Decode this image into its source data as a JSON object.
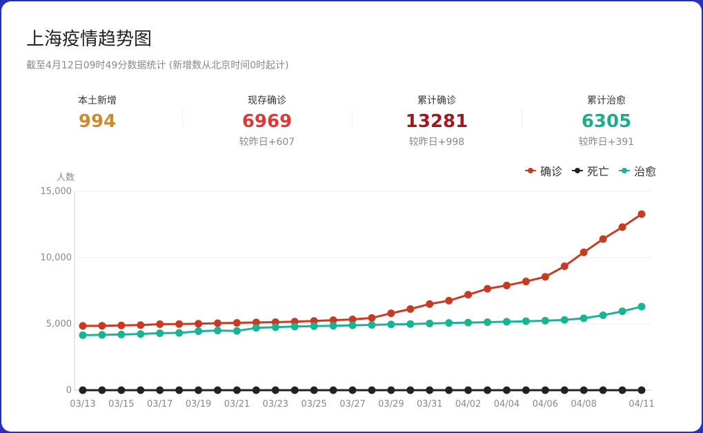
{
  "header": {
    "title": "上海疫情趋势图",
    "subtitle": "截至4月12日09时49分数据统计 (新增数从北京时间0时起计)"
  },
  "stats": [
    {
      "label": "本土新增",
      "value": "994",
      "delta": "",
      "color": "#d08a2c"
    },
    {
      "label": "现存确诊",
      "value": "6969",
      "delta": "较昨日+607",
      "color": "#e0383b"
    },
    {
      "label": "累计确诊",
      "value": "13281",
      "delta": "较昨日+998",
      "color": "#a5171f"
    },
    {
      "label": "累计治愈",
      "value": "6305",
      "delta": "较昨日+391",
      "color": "#1aae8c"
    }
  ],
  "chart_data": {
    "type": "line",
    "ylabel": "人数",
    "ylim": [
      0,
      15000
    ],
    "yticks": [
      "0",
      "5,000",
      "10,000",
      "15,000"
    ],
    "x": [
      "03/13",
      "03/14",
      "03/15",
      "03/16",
      "03/17",
      "03/18",
      "03/19",
      "03/20",
      "03/21",
      "03/22",
      "03/23",
      "03/24",
      "03/25",
      "03/26",
      "03/27",
      "03/28",
      "03/29",
      "03/30",
      "03/31",
      "04/01",
      "04/02",
      "04/03",
      "04/04",
      "04/05",
      "04/06",
      "04/07",
      "04/08",
      "04/09",
      "04/10",
      "04/11"
    ],
    "xtick_labels": [
      "03/13",
      "03/15",
      "03/17",
      "03/19",
      "03/21",
      "03/23",
      "03/25",
      "03/27",
      "03/29",
      "03/31",
      "04/02",
      "04/04",
      "04/06",
      "04/08",
      "04/11"
    ],
    "legend_position": "top-right",
    "grid": true,
    "series": [
      {
        "name": "确诊",
        "color": "#c93a25",
        "values": [
          4850,
          4860,
          4880,
          4910,
          4980,
          4990,
          5010,
          5050,
          5080,
          5110,
          5130,
          5170,
          5220,
          5280,
          5340,
          5450,
          5800,
          6120,
          6500,
          6750,
          7200,
          7650,
          7900,
          8200,
          8550,
          9350,
          10400,
          11400,
          12300,
          13281
        ]
      },
      {
        "name": "死亡",
        "color": "#222222",
        "values": [
          0,
          0,
          0,
          0,
          0,
          0,
          0,
          0,
          0,
          0,
          0,
          0,
          0,
          0,
          0,
          0,
          0,
          0,
          0,
          0,
          0,
          0,
          0,
          0,
          0,
          0,
          0,
          0,
          0,
          0
        ]
      },
      {
        "name": "治愈",
        "color": "#1ab394",
        "values": [
          4150,
          4170,
          4200,
          4240,
          4300,
          4320,
          4450,
          4500,
          4470,
          4700,
          4750,
          4800,
          4830,
          4860,
          4890,
          4920,
          4960,
          4990,
          5030,
          5070,
          5100,
          5130,
          5160,
          5200,
          5240,
          5300,
          5420,
          5650,
          5950,
          6305
        ]
      }
    ]
  }
}
